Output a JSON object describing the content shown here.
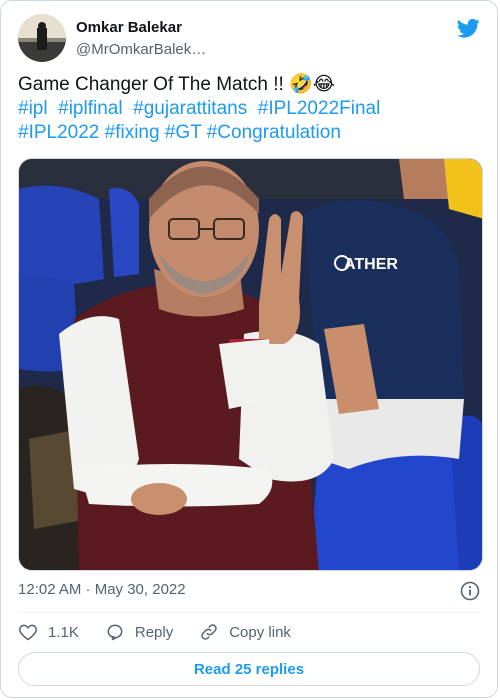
{
  "user": {
    "display_name": "Omkar Balekar",
    "handle": "@MrOmkarBalek…"
  },
  "tweet": {
    "text": "Game Changer Of The Match !! ",
    "emojis": "🤣😂",
    "hashtags_line1": [
      "#ipl",
      "#iplfinal",
      "#gujarattitans",
      "#IPL2022Final"
    ],
    "hashtags_line2": [
      "#IPL2022",
      "#fixing",
      "#GT",
      "#Congratulation"
    ]
  },
  "media": {
    "jersey_brand": "ATHER"
  },
  "meta": {
    "timestamp": "12:02 AM · May 30, 2022"
  },
  "actions": {
    "likes": "1.1K",
    "reply_label": "Reply",
    "copy_link_label": "Copy link"
  },
  "read_replies_label": "Read 25 replies",
  "colors": {
    "accent": "#1d9bf0",
    "text": "#0f1419",
    "muted": "#536471"
  }
}
